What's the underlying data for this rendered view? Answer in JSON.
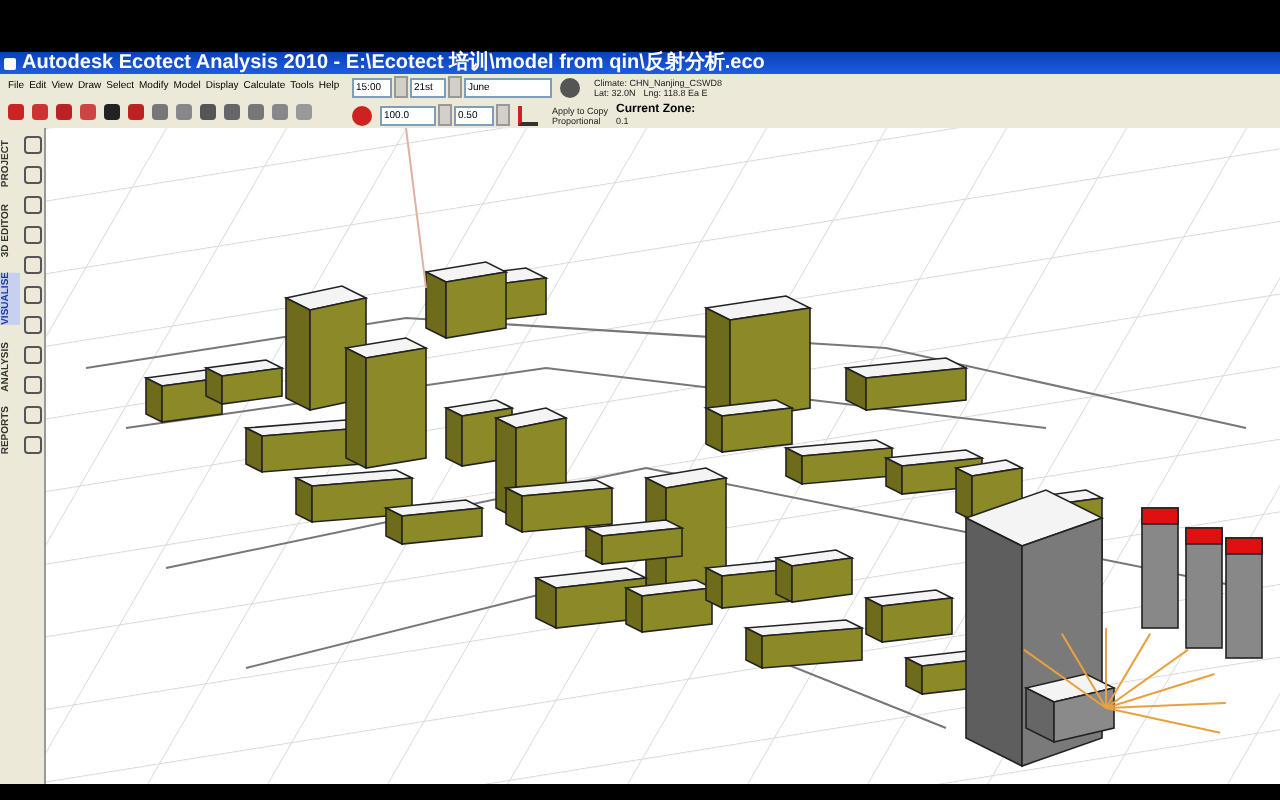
{
  "window": {
    "title": "Autodesk Ecotect Analysis 2010 - E:\\Ecotect 培训\\model from qin\\反射分析.eco"
  },
  "menu": [
    "File",
    "Edit",
    "View",
    "Draw",
    "Select",
    "Modify",
    "Model",
    "Display",
    "Calculate",
    "Tools",
    "Help"
  ],
  "date_time": {
    "time": "15:00",
    "day": "21st",
    "month": "June"
  },
  "climate": {
    "name": "Climate: CHN_Nanjing_CSWD8",
    "lat": "Lat: 32.0N",
    "lng": "Lng: 118.8 Ea E"
  },
  "transform": {
    "value_1": "100.0",
    "value_2": "0.50",
    "apply_to_copy": "Apply to Copy",
    "proportional": "Proportional",
    "current_zone_label": "Current Zone:",
    "current_zone": "0.1"
  },
  "side_tabs": [
    {
      "label": "PROJECT",
      "selected": false
    },
    {
      "label": "3D EDITOR",
      "selected": false
    },
    {
      "label": "VISUALISE",
      "selected": true
    },
    {
      "label": "ANALYSIS",
      "selected": false
    },
    {
      "label": "REPORTS",
      "selected": false
    }
  ]
}
